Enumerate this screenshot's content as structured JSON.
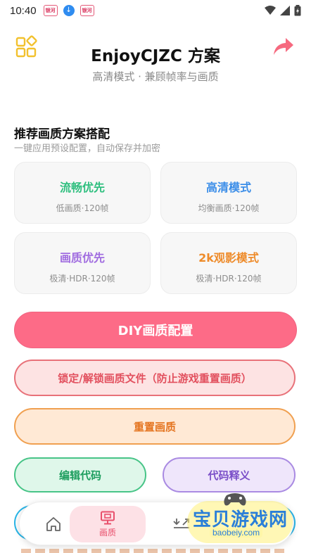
{
  "status_bar": {
    "time": "10:40",
    "notif_app_text": "银河",
    "notif_app2_text": "银河"
  },
  "header": {
    "title": "EnjoyCJZC 方案",
    "subtitle": "高清模式 · 兼顾帧率与画质"
  },
  "section": {
    "title": "推荐画质方案搭配",
    "subtitle": "一键应用预设配置，自动保存并加密"
  },
  "presets": [
    {
      "name": "流畅优先",
      "desc": "低画质·120帧",
      "color": "#2fbf7f"
    },
    {
      "name": "高清模式",
      "desc": "均衡画质·120帧",
      "color": "#3c8ee8"
    },
    {
      "name": "画质优先",
      "desc": "极清·HDR·120帧",
      "color": "#a16de0"
    },
    {
      "name": "2k观影模式",
      "desc": "极清·HDR·120帧",
      "color": "#ee8b2a"
    }
  ],
  "actions": {
    "diy": "DIY画质配置",
    "lock": "锁定/解锁画质文件（防止游戏重置画质）",
    "reset": "重置画质",
    "edit_code": "编辑代码",
    "explain_code": "代码释义"
  },
  "bottom_nav": {
    "quality_label": "画质"
  },
  "watermark": {
    "text": "宝贝游戏网",
    "url": "baobeiy.com"
  },
  "colors": {
    "accent": "#fd6b87",
    "share": "#f6697f",
    "grid_icon": "#f2c12e"
  }
}
